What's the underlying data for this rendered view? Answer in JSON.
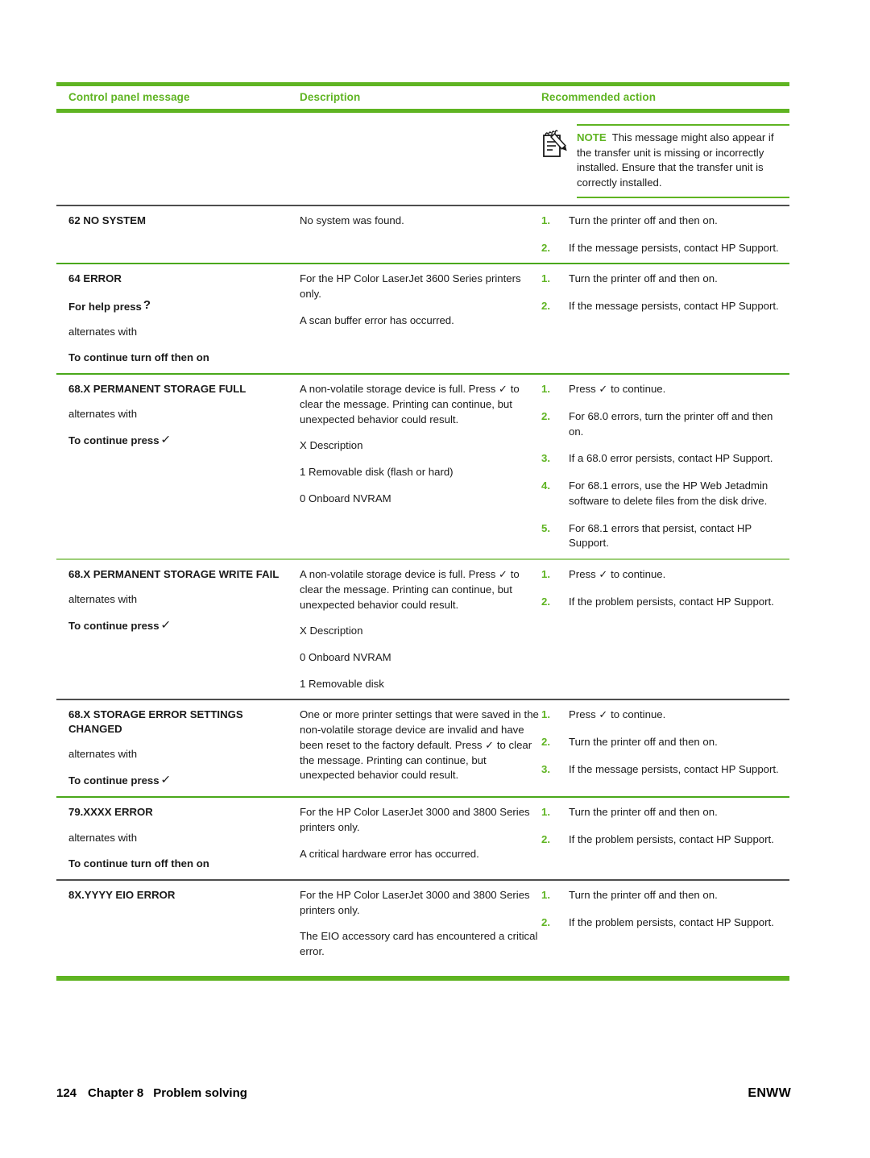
{
  "theme": {
    "green": "#5FB422",
    "green_rule": "#4AA81B",
    "light_green_rule": "#9DCF79",
    "dark_rule": "#4E4E4E"
  },
  "table": {
    "headers": {
      "col1": "Control panel message",
      "col2": "Description",
      "col3": "Recommended action"
    },
    "rows": [
      {
        "id": "note-continuation",
        "separator": "none",
        "message": {
          "title": "",
          "alternates_label": "",
          "continue_label": ""
        },
        "description": [],
        "note": {
          "icon": "note-pencil-icon",
          "label": "NOTE",
          "text": "This message might also appear if the transfer unit is missing or incorrectly installed. Ensure that the transfer unit is correctly installed."
        },
        "actions": []
      },
      {
        "id": "62-no-system",
        "separator": "dark",
        "message": {
          "title": "62 NO SYSTEM"
        },
        "description": [
          "No system was found."
        ],
        "actions": [
          "Turn the printer off and then on.",
          "If the message persists, contact HP Support."
        ]
      },
      {
        "id": "64-error",
        "separator": "green",
        "message": {
          "title": "64 ERROR",
          "help_line": "For help press",
          "help_glyph": "question-mark-glyph",
          "alternates_label": "alternates with",
          "continue_label": "To continue turn off then on"
        },
        "description": [
          "For the HP Color LaserJet 3600 Series printers only.",
          "A scan buffer error has occurred."
        ],
        "actions": [
          "Turn the printer off and then on.",
          "If the message persists, contact HP Support."
        ]
      },
      {
        "id": "68x-permanent-storage-full",
        "separator": "green",
        "message": {
          "title": "68.X PERMANENT STORAGE FULL",
          "alternates_label": "alternates with",
          "continue_label": "To continue press",
          "continue_glyph": "checkmark-glyph"
        },
        "description": [
          "A non-volatile storage device is full. Press ✓ to clear the message. Printing can continue, but unexpected behavior could result.",
          "X Description",
          "1 Removable disk (flash or hard)",
          "0 Onboard NVRAM"
        ],
        "actions": [
          "Press ✓ to continue.",
          "For 68.0 errors, turn the printer off and then on.",
          "If a 68.0 error persists, contact HP Support.",
          "For 68.1 errors, use the HP Web Jetadmin software to delete files from the disk drive.",
          "For 68.1 errors that persist, contact HP Support."
        ]
      },
      {
        "id": "68x-permanent-storage-write-fail",
        "separator": "lightgreen",
        "message": {
          "title": "68.X PERMANENT STORAGE WRITE FAIL",
          "alternates_label": "alternates with",
          "continue_label": "To continue press",
          "continue_glyph": "checkmark-glyph"
        },
        "description": [
          "A non-volatile storage device is full. Press ✓ to clear the message. Printing can continue, but unexpected behavior could result.",
          "X Description",
          "0 Onboard NVRAM",
          "1 Removable disk"
        ],
        "actions": [
          "Press ✓ to continue.",
          "If the problem persists, contact HP Support."
        ]
      },
      {
        "id": "68x-storage-error-settings-changed",
        "separator": "dark",
        "message": {
          "title": "68.X STORAGE ERROR SETTINGS CHANGED",
          "alternates_label": "alternates with",
          "continue_label": "To continue press",
          "continue_glyph": "checkmark-glyph"
        },
        "description": [
          "One or more printer settings that were saved in the non-volatile storage device are invalid and have been reset to the factory default. Press ✓ to clear the message. Printing can continue, but unexpected behavior could result."
        ],
        "actions": [
          "Press ✓ to continue.",
          "Turn the printer off and then on.",
          "If the message persists, contact HP Support."
        ]
      },
      {
        "id": "79-xxxx-error",
        "separator": "green",
        "message": {
          "title": "79.XXXX ERROR",
          "alternates_label": "alternates with",
          "continue_label": "To continue turn off then on"
        },
        "description": [
          "For the HP Color LaserJet 3000 and 3800 Series printers only.",
          "A critical hardware error has occurred."
        ],
        "actions": [
          "Turn the printer off and then on.",
          "If the problem persists, contact HP Support."
        ]
      },
      {
        "id": "8x-yyyy-eio-error",
        "separator": "dark",
        "message": {
          "title": "8X.YYYY EIO ERROR"
        },
        "description": [
          "For the HP Color LaserJet 3000 and 3800 Series printers only.",
          "The EIO accessory card has encountered a critical error."
        ],
        "actions": [
          "Turn the printer off and then on.",
          "If the problem persists, contact HP Support."
        ]
      }
    ]
  },
  "footer": {
    "page_number": "124",
    "chapter_label": "Chapter",
    "chapter_number": "8",
    "chapter_title": "Problem solving",
    "right_label": "ENWW"
  }
}
